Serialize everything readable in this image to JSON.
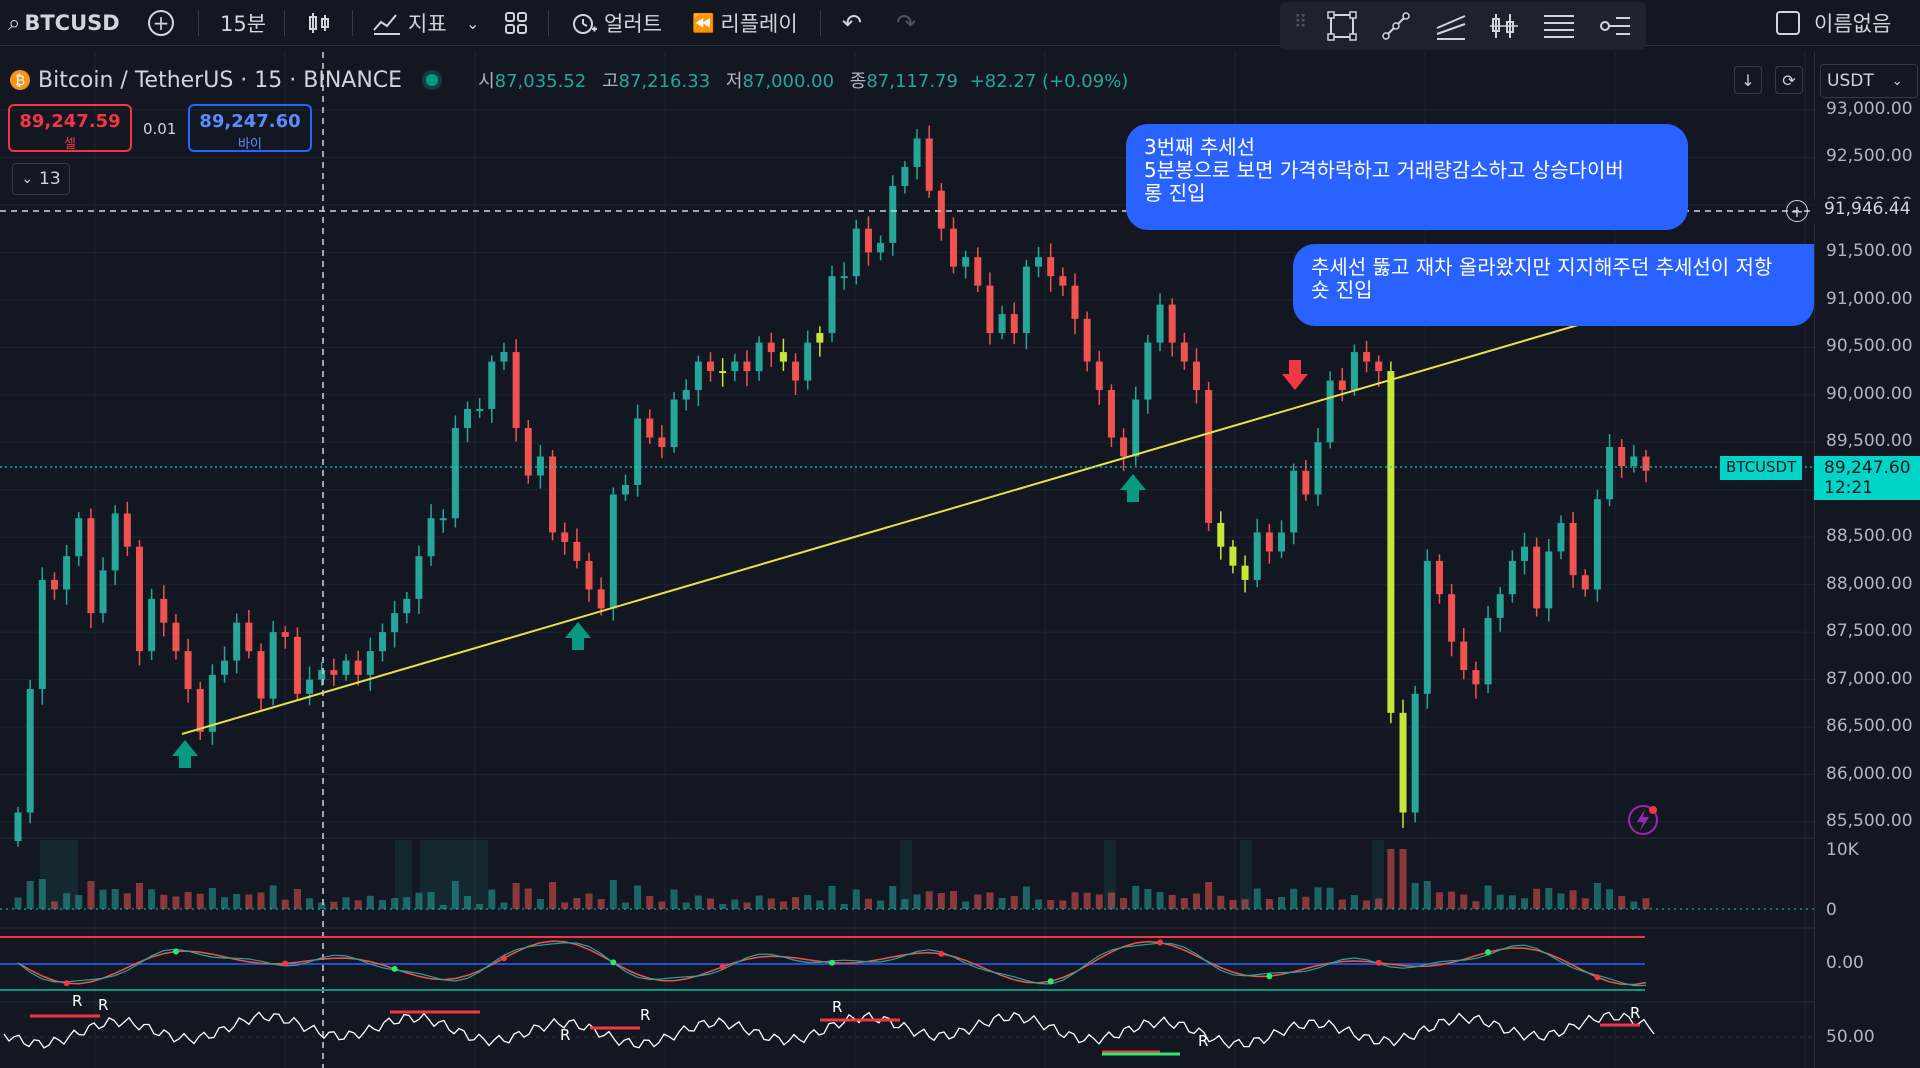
{
  "toolbar": {
    "symbol": "BTCUSD",
    "interval": "15분",
    "indicators": "지표",
    "alerts": "얼러트",
    "replay": "리플레이",
    "layout_name": "이름없음"
  },
  "header": {
    "title": "Bitcoin / TetherUS · 15 · BINANCE",
    "o_label": "시",
    "o_value": "87,035.52",
    "h_label": "고",
    "h_value": "87,216.33",
    "l_label": "저",
    "l_value": "87,000.00",
    "c_label": "종",
    "c_value": "87,117.79",
    "change": "+82.27 (+0.09%)"
  },
  "trade": {
    "sell_price": "89,247.59",
    "sell_label": "셀",
    "spread": "0.01",
    "buy_price": "89,247.60",
    "buy_label": "바이",
    "drawings_count": "13"
  },
  "axis": {
    "currency": "USDT",
    "ticks": [
      "93,000.00",
      "92,500.00",
      "92,000.00",
      "91,500.00",
      "91,000.00",
      "90,500.00",
      "90,000.00",
      "89,500.00",
      "89,000.00",
      "88,500.00",
      "88,000.00",
      "87,500.00",
      "87,000.00",
      "86,500.00",
      "86,000.00",
      "85,500.00"
    ],
    "crosshair_price": "91,946.44",
    "current_symbol": "BTCUSDT",
    "current_price": "89,247.60",
    "countdown": "12:21",
    "volume_top": "10K",
    "volume_zero": "0",
    "osc1_label": "0.00",
    "osc2_label": "50.00"
  },
  "annotations": {
    "note1": "3번째 추세선\n5분봉으로 보면 가격하락하고 거래량감소하고 상승다이버\n롱 진입",
    "note2": "추세선 뚫고 재차 올라왔지만 지지해주던 추세선이 저항\n숏 진입"
  },
  "rsi_markers": [
    "R",
    "R",
    "R",
    "R",
    "R",
    "R",
    "R"
  ],
  "colors": {
    "up": "#26a69a",
    "down": "#ef5350",
    "accent": "#2962ff",
    "trend": "#e6e04b",
    "highlight": "#c8e639",
    "price_tag": "#00d4c7"
  },
  "chart_data": {
    "type": "candlestick",
    "title": "Bitcoin / TetherUS · 15 · BINANCE",
    "ylim": [
      85300,
      93050
    ],
    "closes": [
      85600,
      86900,
      88050,
      87950,
      88300,
      88700,
      87700,
      88150,
      88750,
      88400,
      87300,
      87850,
      87600,
      87300,
      86900,
      86450,
      87050,
      87200,
      87600,
      87300,
      86800,
      87500,
      87450,
      86850,
      87000,
      87100,
      87050,
      87200,
      87050,
      87300,
      87500,
      87700,
      87850,
      88300,
      88700,
      88700,
      89650,
      89850,
      89850,
      90350,
      90450,
      89650,
      89150,
      89350,
      88550,
      88450,
      88250,
      87950,
      87750,
      88950,
      89050,
      89750,
      89550,
      89450,
      89950,
      90050,
      90350,
      90250,
      90250,
      90350,
      90250,
      90550,
      90450,
      90350,
      90150,
      90550,
      90650,
      91250,
      91250,
      91750,
      91500,
      91600,
      92200,
      92400,
      92700,
      92150,
      91750,
      91350,
      91450,
      91150,
      90650,
      90850,
      90650,
      91350,
      91450,
      91250,
      91150,
      90800,
      90350,
      90050,
      89550,
      89350,
      89950,
      90550,
      90950,
      90550,
      90350,
      90050,
      88650,
      88400,
      88200,
      88050,
      88550,
      88350,
      88550,
      89200,
      88950,
      89500,
      90150,
      90050,
      90450,
      90350,
      90250,
      86650,
      85600,
      86850,
      88250,
      87900,
      87400,
      87100,
      86950,
      87650,
      87900,
      88250,
      88400,
      87750,
      88350,
      88650,
      88100,
      87950,
      88900,
      89450,
      89250,
      89350,
      89200
    ]
  }
}
